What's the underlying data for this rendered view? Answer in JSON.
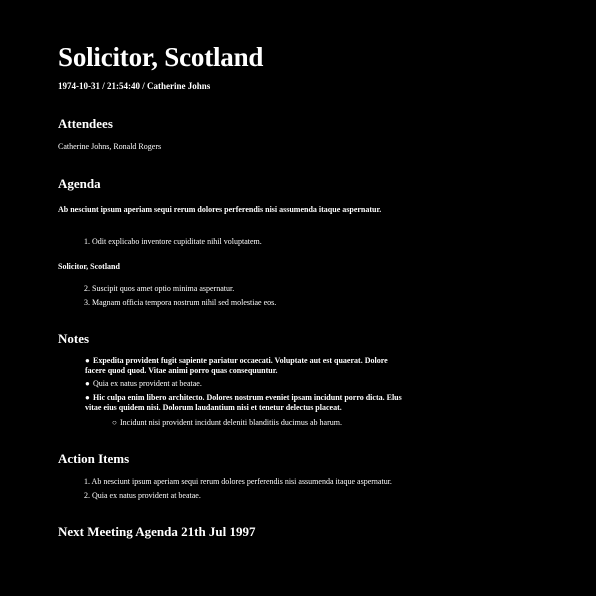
{
  "document": {
    "title": "Solicitor, Scotland",
    "meta": "1974-10-31 / 21:54:40 / Catherine Johns"
  },
  "attendees": {
    "heading": "Attendees",
    "names": "Catherine Johns, Ronald Rogers"
  },
  "agenda": {
    "heading": "Agenda",
    "intro": "Ab nesciunt ipsum aperiam sequi rerum dolores perferendis nisi assumenda itaque aspernatur.",
    "items_a": [
      "1. Odit explicabo inventore cupiditate nihil voluptatem."
    ],
    "subheading": "Solicitor, Scotland",
    "items_b": [
      "2. Suscipit quos amet optio minima aspernatur.",
      "3. Magnam officia tempora nostrum nihil sed molestiae eos."
    ]
  },
  "notes": {
    "heading": "Notes",
    "bullet_symbol": "●",
    "sub_bullet_symbol": "○",
    "items": [
      "Expedita provident fugit sapiente pariatur occaecati. Voluptate aut est quaerat. Dolore facere quod quod. Vitae animi porro quas consequuntur.",
      "Quia ex natus provident at beatae.",
      "Hic culpa enim libero architecto. Dolores nostrum eveniet ipsam incidunt porro dicta. Elus vitae eius quidem nisi. Dolorum laudantium nisi et tenetur delectus placeat."
    ],
    "sub_items": [
      "Incidunt nisi provident incidunt deleniti blanditiis ducimus ab harum."
    ]
  },
  "action_items": {
    "heading": "Action Items",
    "items": [
      "1. Ab nesciunt ipsum aperiam sequi rerum dolores perferendis nisi assumenda itaque aspernatur.",
      "2. Quia ex natus provident at beatae."
    ]
  },
  "next_meeting": {
    "heading": "Next Meeting Agenda 21th Jul 1997"
  }
}
